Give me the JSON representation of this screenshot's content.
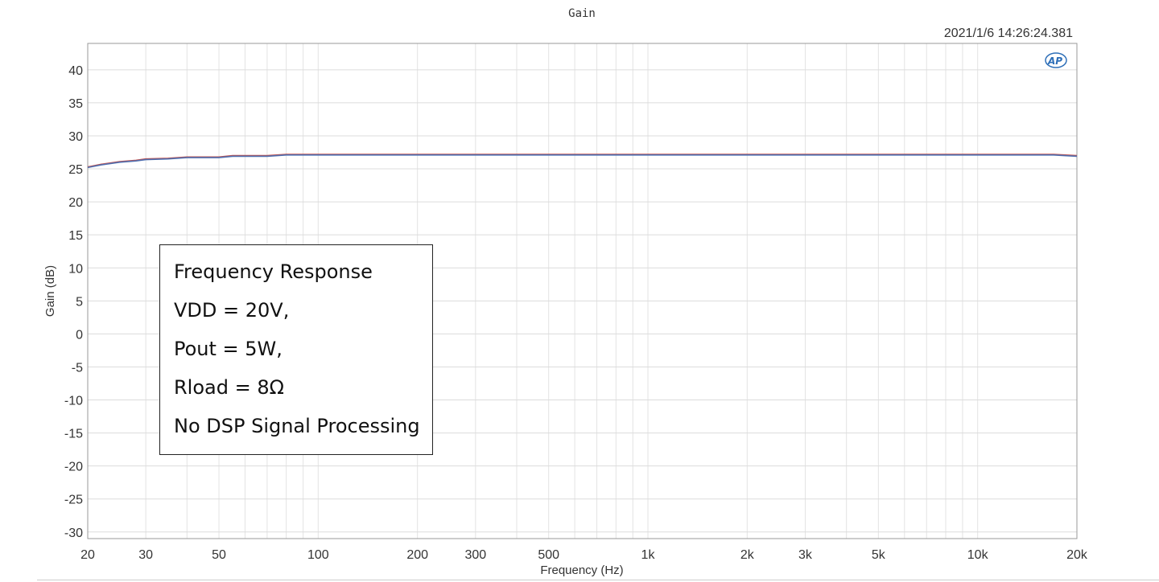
{
  "chart_data": {
    "type": "line",
    "title": "Gain",
    "timestamp": "2021/1/6 14:26:24.381",
    "logo": "AP",
    "xlabel": "Frequency (Hz)",
    "ylabel": "Gain (dB)",
    "x_scale": "log",
    "xlim": [
      20,
      20000
    ],
    "ylim": [
      -31,
      44
    ],
    "grid": true,
    "x_ticks": [
      {
        "value": 20,
        "label": "20"
      },
      {
        "value": 30,
        "label": "30"
      },
      {
        "value": 50,
        "label": "50"
      },
      {
        "value": 100,
        "label": "100"
      },
      {
        "value": 200,
        "label": "200"
      },
      {
        "value": 300,
        "label": "300"
      },
      {
        "value": 500,
        "label": "500"
      },
      {
        "value": 1000,
        "label": "1k"
      },
      {
        "value": 2000,
        "label": "2k"
      },
      {
        "value": 3000,
        "label": "3k"
      },
      {
        "value": 5000,
        "label": "5k"
      },
      {
        "value": 10000,
        "label": "10k"
      },
      {
        "value": 20000,
        "label": "20k"
      }
    ],
    "y_ticks": [
      40,
      35,
      30,
      25,
      20,
      15,
      10,
      5,
      0,
      -5,
      -10,
      -15,
      -20,
      -25,
      -30
    ],
    "series": [
      {
        "color": "#c0504d",
        "x": [
          20,
          22,
          25,
          28,
          30,
          35,
          40,
          50,
          55,
          70,
          80,
          100,
          200,
          500,
          1000,
          2000,
          5000,
          10000,
          17000,
          20000
        ],
        "y": [
          25.3,
          25.7,
          26.1,
          26.3,
          26.5,
          26.6,
          26.8,
          26.8,
          27.0,
          27.0,
          27.2,
          27.2,
          27.2,
          27.2,
          27.2,
          27.2,
          27.2,
          27.2,
          27.2,
          27.0
        ]
      },
      {
        "color": "#4f6fb0",
        "x": [
          20,
          22,
          25,
          28,
          30,
          35,
          40,
          50,
          55,
          70,
          80,
          100,
          200,
          500,
          1000,
          2000,
          5000,
          10000,
          17000,
          20000
        ],
        "y": [
          25.2,
          25.6,
          26.0,
          26.2,
          26.4,
          26.5,
          26.7,
          26.7,
          26.9,
          26.9,
          27.1,
          27.1,
          27.1,
          27.1,
          27.1,
          27.1,
          27.1,
          27.1,
          27.1,
          26.9
        ]
      }
    ]
  },
  "annotation": {
    "lines": [
      "Frequency Response",
      "VDD = 20V,",
      "Pout = 5W,",
      "Rload = 8Ω",
      "No DSP Signal Processing"
    ]
  }
}
